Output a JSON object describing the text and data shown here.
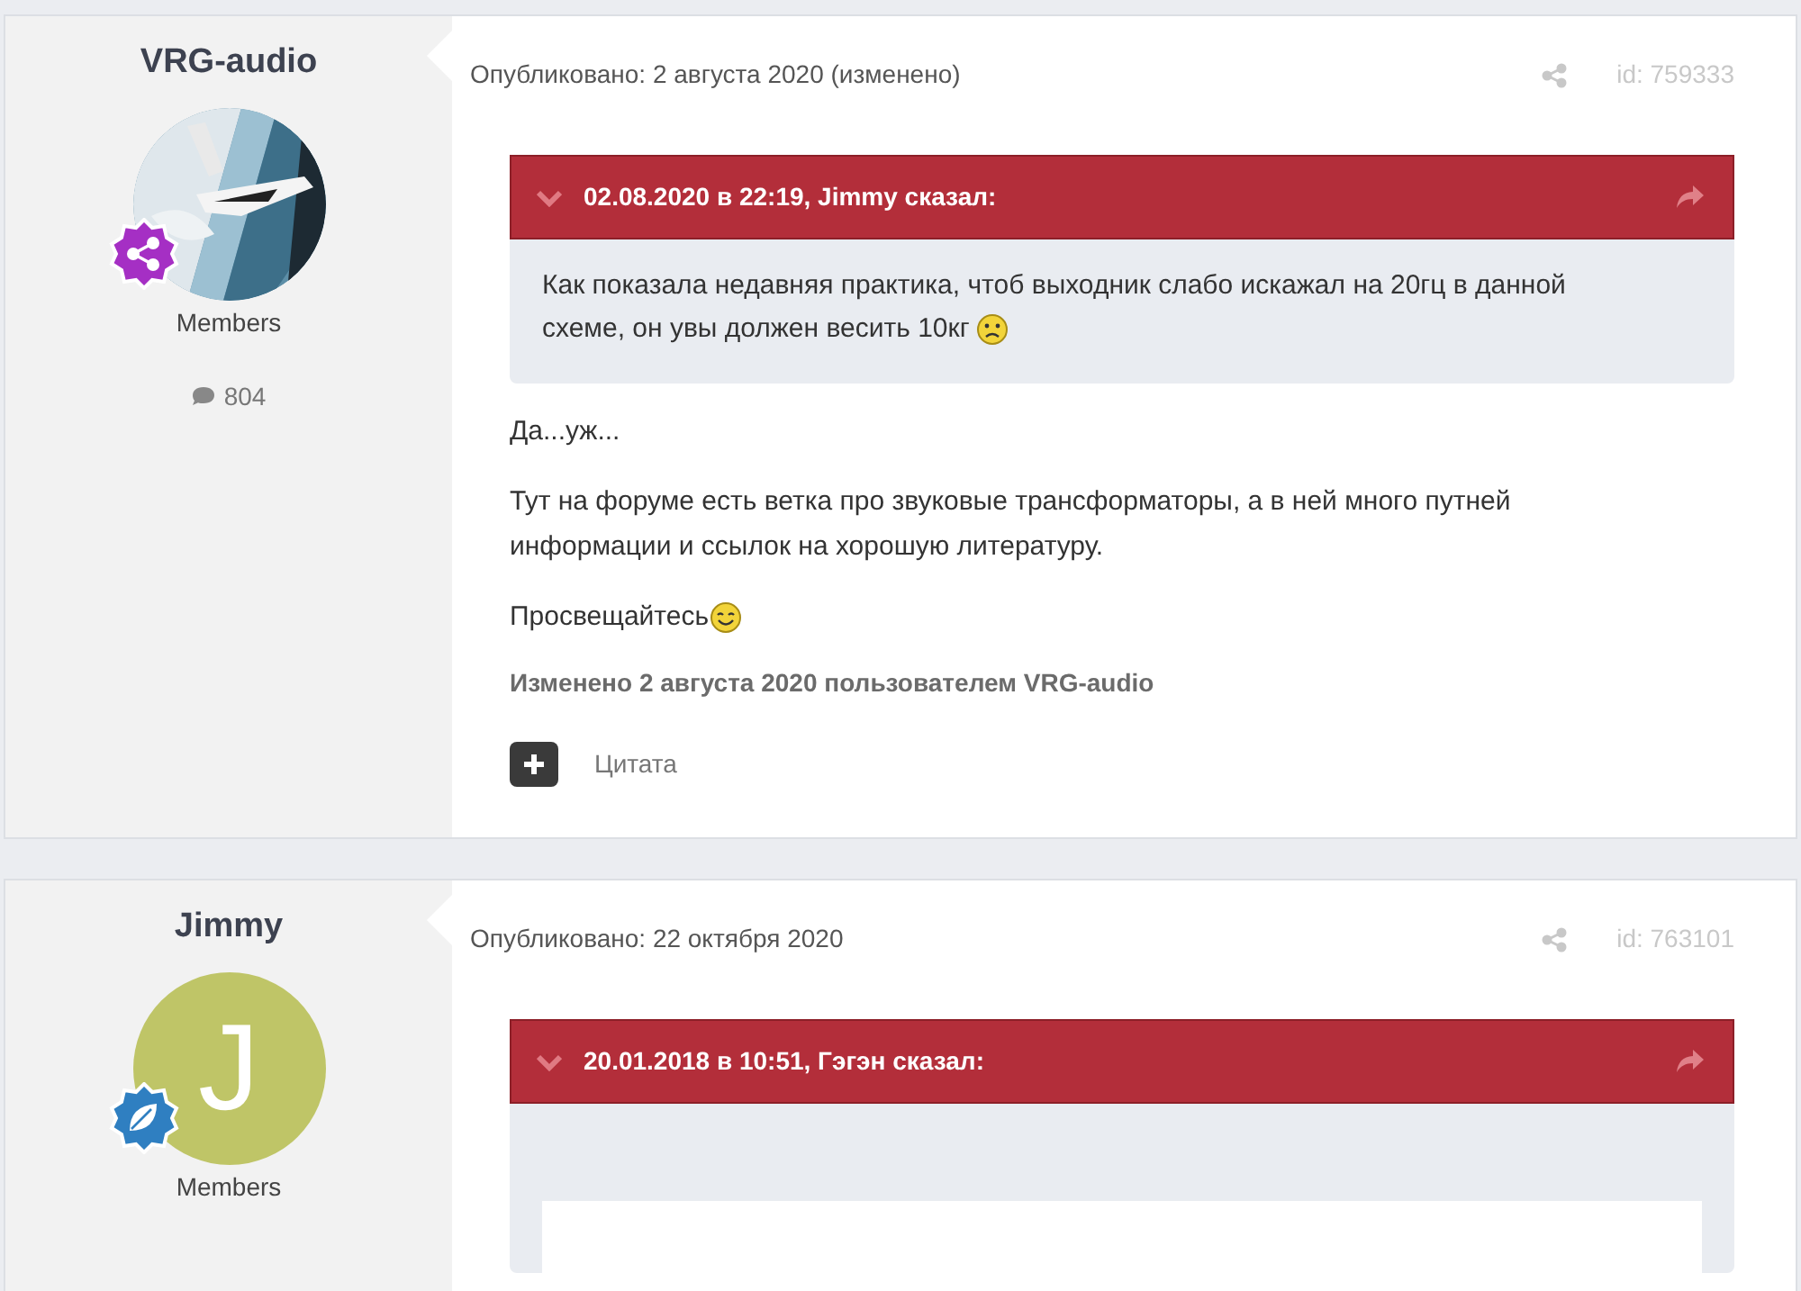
{
  "posts": [
    {
      "author": "VRG-audio",
      "badge": {
        "kind": "share",
        "color": "#a52fc4"
      },
      "group": "Members",
      "post_count": "804",
      "published": "Опубликовано: 2 августа 2020 (изменено)",
      "post_id": "id: 759333",
      "quote": {
        "header": "02.08.2020 в 22:19, Jimmy сказал:",
        "text": "Как показала недавняя практика, чтоб выходник слабо искажал на 20гц в данной схеме, он увы должен весить 10кг",
        "emoji": {
          "kind": "sad"
        }
      },
      "paragraphs": [
        {
          "text": "Да...уж..."
        },
        {
          "text": "Тут на форуме есть ветка про звуковые трансформаторы, а в ней много путней информации и ссылок на хорошую литературу."
        },
        {
          "text": "Просвещайтесь",
          "emoji": {
            "kind": "smile"
          }
        }
      ],
      "edited": "Изменено 2 августа 2020 пользователем VRG-audio",
      "quote_button": "Цитата"
    },
    {
      "author": "Jimmy",
      "avatar": {
        "kind": "letter",
        "letter": "J",
        "color": "#bfc567"
      },
      "badge": {
        "kind": "leaf",
        "color": "#2f7fc1"
      },
      "group": "Members",
      "published": "Опубликовано: 22 октября 2020",
      "post_id": "id: 763101",
      "quote": {
        "header": "20.01.2018 в 10:51, Гэгэн сказал:"
      }
    }
  ]
}
